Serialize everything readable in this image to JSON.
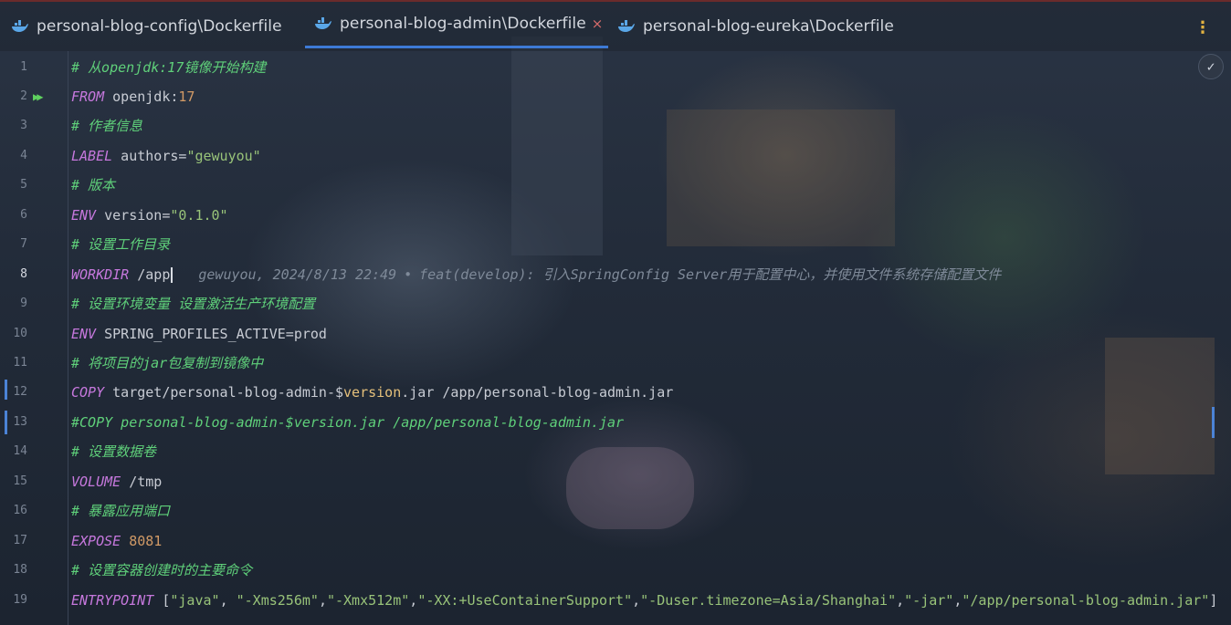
{
  "tabs": [
    {
      "label": "personal-blog-config\\Dockerfile",
      "active": false,
      "icon": "docker-whale-icon"
    },
    {
      "label": "personal-blog-admin\\Dockerfile",
      "active": true,
      "icon": "docker-whale-icon",
      "close": "×"
    },
    {
      "label": "personal-blog-eureka\\Dockerfile",
      "active": false,
      "icon": "docker-whale-icon"
    }
  ],
  "more_menu": "⋮",
  "inspection_status": "✓",
  "current_line": 8,
  "lines": [
    {
      "n": "1",
      "parts": [
        {
          "c": "cm",
          "t": "# 从openjdk:17镜像开始构建"
        }
      ]
    },
    {
      "n": "2",
      "parts": [
        {
          "c": "kw",
          "t": "FROM"
        },
        {
          "c": "pl",
          "t": " openjdk:"
        },
        {
          "c": "num",
          "t": "17"
        }
      ]
    },
    {
      "n": "3",
      "parts": [
        {
          "c": "cm",
          "t": "# 作者信息"
        }
      ]
    },
    {
      "n": "4",
      "parts": [
        {
          "c": "kw",
          "t": "LABEL"
        },
        {
          "c": "pl",
          "t": " authors="
        },
        {
          "c": "str",
          "t": "\"gewuyou\""
        }
      ]
    },
    {
      "n": "5",
      "parts": [
        {
          "c": "cm",
          "t": "# 版本"
        }
      ]
    },
    {
      "n": "6",
      "parts": [
        {
          "c": "kw",
          "t": "ENV"
        },
        {
          "c": "pl",
          "t": " version="
        },
        {
          "c": "str",
          "t": "\"0.1.0\""
        }
      ]
    },
    {
      "n": "7",
      "parts": [
        {
          "c": "cm",
          "t": "# 设置工作目录"
        }
      ]
    },
    {
      "n": "8",
      "parts": [
        {
          "c": "kw",
          "t": "WORKDIR"
        },
        {
          "c": "pl",
          "t": " /app"
        }
      ]
    },
    {
      "n": "9",
      "parts": [
        {
          "c": "cm",
          "t": "# 设置环境变量 设置激活生产环境配置"
        }
      ]
    },
    {
      "n": "10",
      "parts": [
        {
          "c": "kw",
          "t": "ENV"
        },
        {
          "c": "pl",
          "t": " SPRING_PROFILES_ACTIVE=prod"
        }
      ]
    },
    {
      "n": "11",
      "parts": [
        {
          "c": "cm",
          "t": "# 将项目的jar包复制到镜像中"
        }
      ]
    },
    {
      "n": "12",
      "parts": [
        {
          "c": "kw",
          "t": "COPY"
        },
        {
          "c": "pl",
          "t": " target/personal-blog-admin-$"
        },
        {
          "c": "var",
          "t": "version"
        },
        {
          "c": "pl",
          "t": ".jar /app/personal-blog-admin.jar"
        }
      ]
    },
    {
      "n": "13",
      "parts": [
        {
          "c": "cm",
          "t": "#COPY personal-blog-admin-$version.jar /app/personal-blog-admin.jar"
        }
      ]
    },
    {
      "n": "14",
      "parts": [
        {
          "c": "cm",
          "t": "# 设置数据卷"
        }
      ]
    },
    {
      "n": "15",
      "parts": [
        {
          "c": "kw",
          "t": "VOLUME"
        },
        {
          "c": "pl",
          "t": " /tmp"
        }
      ]
    },
    {
      "n": "16",
      "parts": [
        {
          "c": "cm",
          "t": "# 暴露应用端口"
        }
      ]
    },
    {
      "n": "17",
      "parts": [
        {
          "c": "kw",
          "t": "EXPOSE"
        },
        {
          "c": "num",
          "t": " 8081"
        }
      ]
    },
    {
      "n": "18",
      "parts": [
        {
          "c": "cm",
          "t": "# 设置容器创建时的主要命令"
        }
      ]
    },
    {
      "n": "19",
      "parts": [
        {
          "c": "kw",
          "t": "ENTRYPOINT"
        },
        {
          "c": "pl",
          "t": " ["
        },
        {
          "c": "str",
          "t": "\"java\""
        },
        {
          "c": "pl",
          "t": ", "
        },
        {
          "c": "str",
          "t": "\"-Xms256m\""
        },
        {
          "c": "pl",
          "t": ","
        },
        {
          "c": "str",
          "t": "\"-Xmx512m\""
        },
        {
          "c": "pl",
          "t": ","
        },
        {
          "c": "str",
          "t": "\"-XX:+UseContainerSupport\""
        },
        {
          "c": "pl",
          "t": ","
        },
        {
          "c": "str",
          "t": "\"-Duser.timezone=Asia/Shanghai\""
        },
        {
          "c": "pl",
          "t": ","
        },
        {
          "c": "str",
          "t": "\"-jar\""
        },
        {
          "c": "pl",
          "t": ","
        },
        {
          "c": "str",
          "t": "\"/app/personal-blog-admin.jar\""
        },
        {
          "c": "pl",
          "t": "]"
        }
      ]
    }
  ],
  "blame": {
    "author": "gewuyou,",
    "date": "2024/8/13 22:49",
    "separator": "•",
    "message": "feat(develop): 引入SpringConfig Server用于配置中心，并使用文件系统存储配置文件"
  },
  "colors": {
    "keyword": "#c678dd",
    "comment": "#5fd07a",
    "string": "#98c379",
    "number": "#d19a66",
    "active_tab_underline": "#3d7ad6"
  }
}
